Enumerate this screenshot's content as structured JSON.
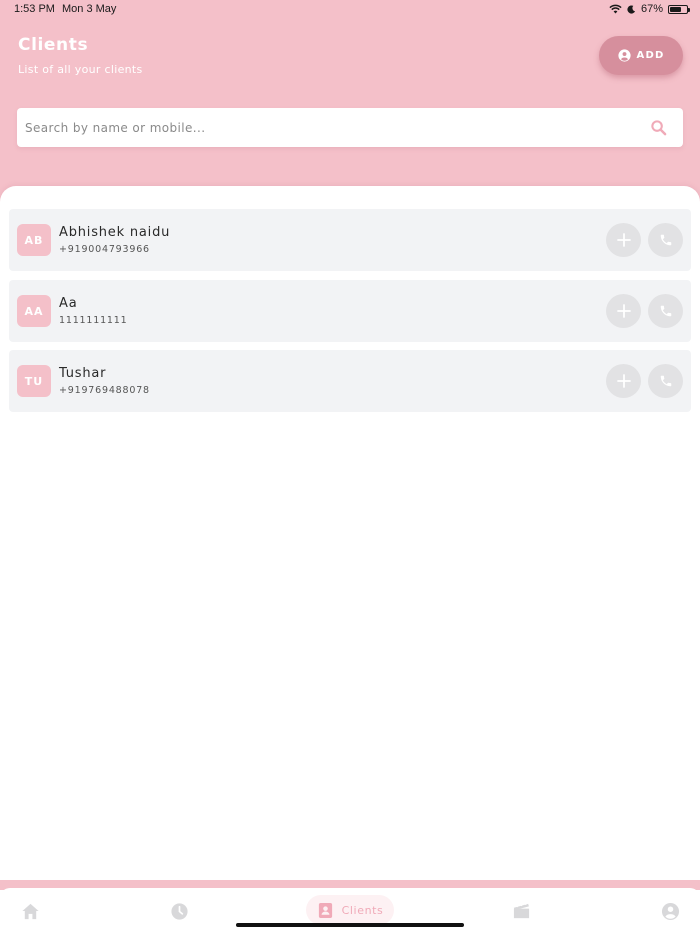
{
  "status_bar": {
    "time": "1:53 PM",
    "date": "Mon 3 May",
    "battery": "67%",
    "battery_level": 0.67
  },
  "header": {
    "title": "Clients",
    "subtitle": "List of all your clients",
    "add_label": "ADD"
  },
  "search": {
    "placeholder": "Search by name or mobile...",
    "value": ""
  },
  "clients": [
    {
      "initials": "AB",
      "name": "Abhishek naidu",
      "phone": "+919004793966"
    },
    {
      "initials": "AA",
      "name": "Aa",
      "phone": "1111111111"
    },
    {
      "initials": "TU",
      "name": "Tushar",
      "phone": "+919769488078"
    }
  ],
  "tabbar": {
    "items": [
      {
        "icon": "home-icon",
        "label": ""
      },
      {
        "icon": "history-icon",
        "label": ""
      },
      {
        "icon": "clients-icon",
        "label": "Clients",
        "active": true
      },
      {
        "icon": "media-icon",
        "label": ""
      },
      {
        "icon": "profile-icon",
        "label": ""
      }
    ]
  },
  "colors": {
    "brand_pink": "#f4c0c9",
    "button_pink": "#d68f9d",
    "card_bg": "#f2f3f5",
    "icon_grey": "#d8d8da"
  }
}
